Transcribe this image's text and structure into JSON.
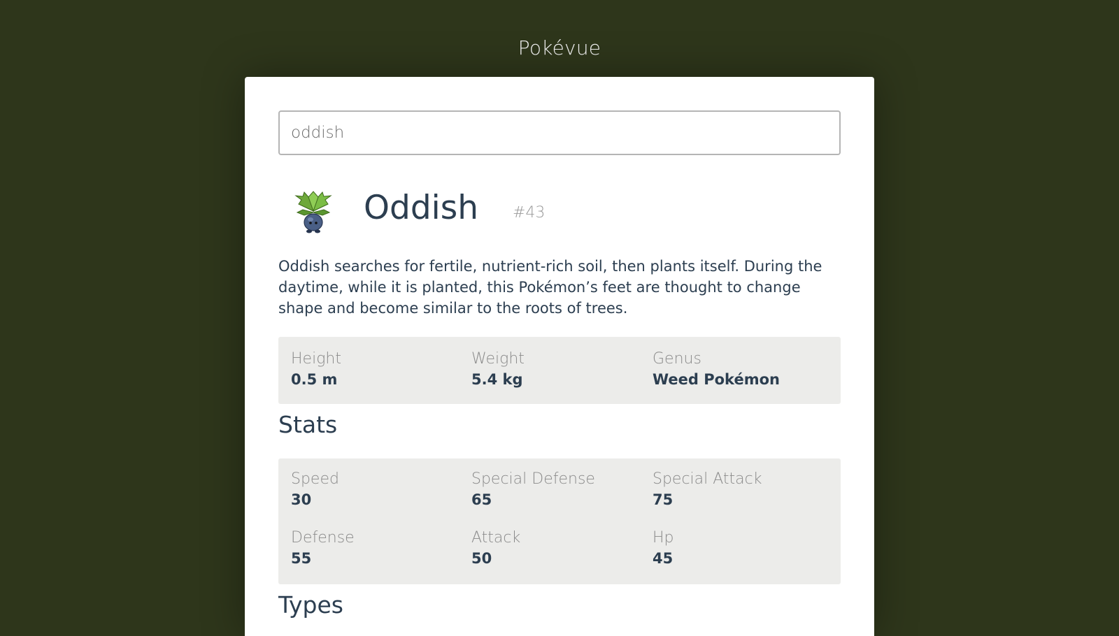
{
  "app": {
    "title": "Pokévue"
  },
  "search": {
    "value": "oddish",
    "placeholder": ""
  },
  "pokemon": {
    "name": "Oddish",
    "number": "#43",
    "sprite_icon": "oddish-sprite-icon",
    "description": "Oddish searches for fertile, nutrient-rich soil, then plants itself. During the daytime, while it is planted, this Pokémon’s feet are thought to change shape and become similar to the roots of trees."
  },
  "basic_info": [
    {
      "label": "Height",
      "value": "0.5 m"
    },
    {
      "label": "Weight",
      "value": "5.4 kg"
    },
    {
      "label": "Genus",
      "value": "Weed Pokémon"
    }
  ],
  "stats": {
    "heading": "Stats",
    "items": [
      {
        "label": "Speed",
        "value": "30"
      },
      {
        "label": "Special Defense",
        "value": "65"
      },
      {
        "label": "Special Attack",
        "value": "75"
      },
      {
        "label": "Defense",
        "value": "55"
      },
      {
        "label": "Attack",
        "value": "50"
      },
      {
        "label": "Hp",
        "value": "45"
      }
    ]
  },
  "types": {
    "heading": "Types"
  },
  "colors": {
    "background": "#2e361b",
    "card": "#ffffff",
    "panel": "#ececea",
    "text": "#2c3e50",
    "muted": "#8a8a8a"
  }
}
